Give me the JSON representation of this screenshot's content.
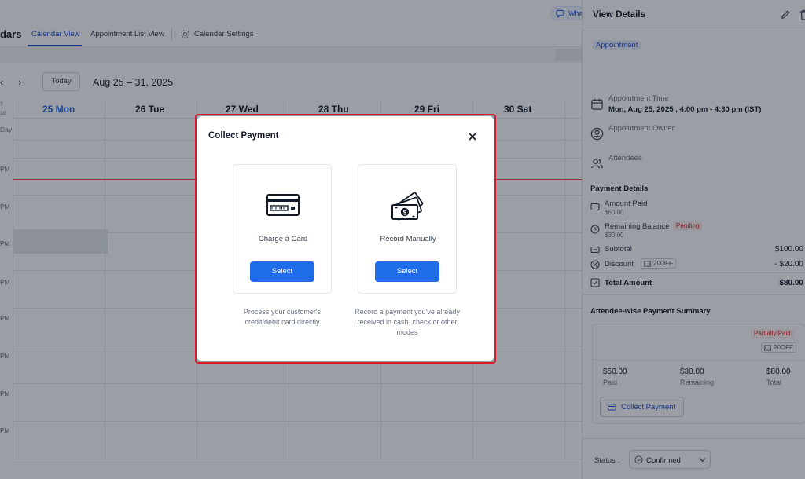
{
  "app": {
    "title_fragment": "dars",
    "tabs": [
      {
        "label": "Calendar View",
        "active": true
      },
      {
        "label": "Appointment List View",
        "active": false
      },
      {
        "label": "Calendar Settings",
        "active": false
      }
    ],
    "whatsapp_chip": "Wha"
  },
  "calendar": {
    "today_label": "Today",
    "date_range": "Aug 25 – 31, 2025",
    "gmt_top": "T",
    "gmt_bottom": "30",
    "all_day": "Day",
    "days": [
      "25 Mon",
      "26 Tue",
      "27 Wed",
      "28 Thu",
      "29 Fri",
      "30 Sat"
    ],
    "hour_label": "PM"
  },
  "panel": {
    "title": "View Details",
    "badge": "Appointment",
    "time_label": "Appointment Time",
    "time_value": "Mon, Aug 25, 2025 , 4:00 pm - 4:30 pm (IST)",
    "owner_label": "Appointment Owner",
    "attendees_label": "Attendees",
    "payment_title": "Payment Details",
    "amount_paid_label": "Amount Paid",
    "amount_paid_value": "$50.00",
    "remaining_label": "Remaining Balance",
    "remaining_status": "Pending",
    "remaining_value": "$30.00",
    "subtotal_label": "Subtotal",
    "subtotal_value": "$100.00",
    "discount_label": "Discount",
    "discount_code": "20OFF",
    "discount_value": "- $20.00",
    "total_label": "Total Amount",
    "total_value": "$80.00",
    "summary_title": "Attendee-wise Payment Summary",
    "summary_status": "Partially Paid",
    "summary_coupon": "20OFF",
    "summary": [
      {
        "value": "$50.00",
        "label": "Paid"
      },
      {
        "value": "$30.00",
        "label": "Remaining"
      },
      {
        "value": "$80.00",
        "label": "Total"
      }
    ],
    "collect_button": "Collect Payment",
    "status_label": "Status :",
    "status_value": "Confirmed"
  },
  "modal": {
    "title": "Collect Payment",
    "options": [
      {
        "title": "Charge a Card",
        "button": "Select",
        "description": "Process your customer's credit/debit card directly"
      },
      {
        "title": "Record Manually",
        "button": "Select",
        "description": "Record a payment you've already received in cash, check or other modes"
      }
    ]
  },
  "colors": {
    "accent": "#1f6ce8",
    "modal_highlight": "#d01f2a",
    "today": "#2563eb",
    "now_line": "#ef4444",
    "pending": "#dc2626"
  }
}
